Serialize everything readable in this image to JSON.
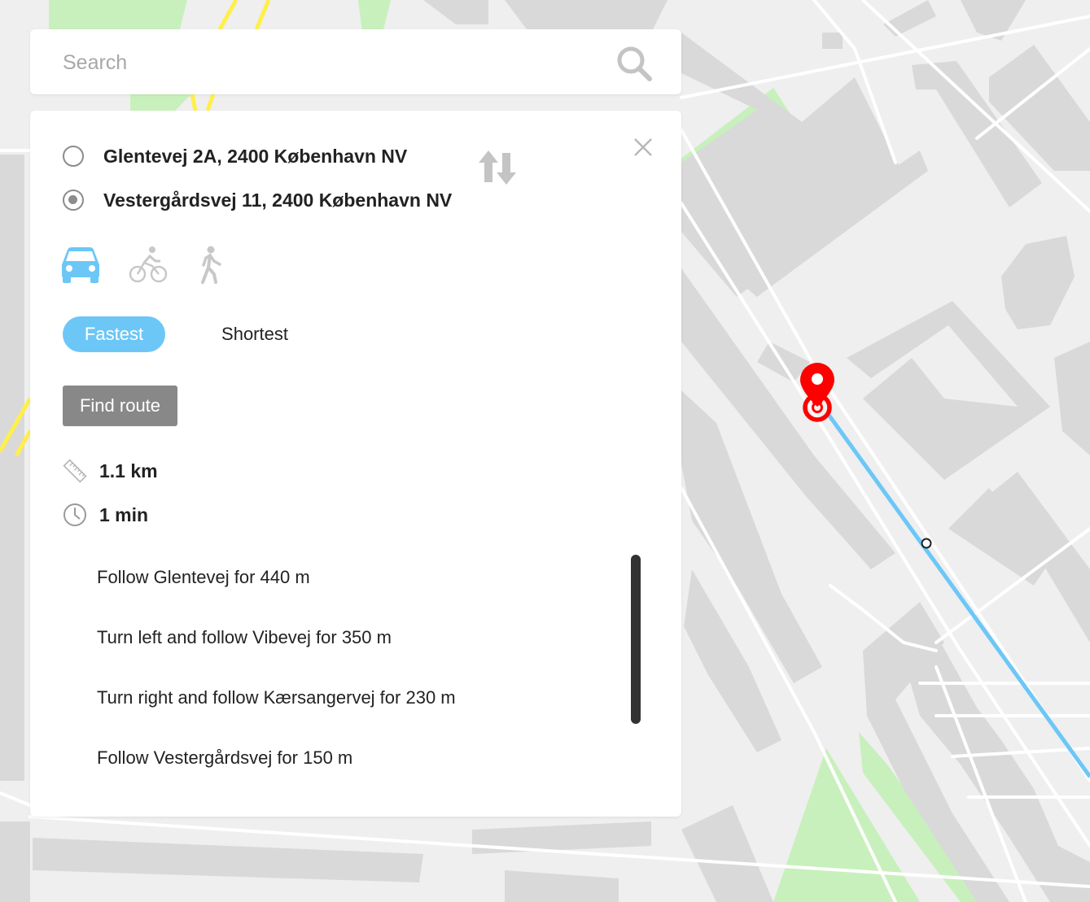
{
  "search": {
    "placeholder": "Search"
  },
  "route": {
    "origin": "Glentevej 2A, 2400 København NV",
    "destination": "Vestergårdsvej 11, 2400 København NV",
    "selected_location": "destination",
    "modes": [
      {
        "name": "car",
        "icon": "car-icon",
        "active": true
      },
      {
        "name": "bicycle",
        "icon": "bicycle-icon",
        "active": false
      },
      {
        "name": "walk",
        "icon": "pedestrian-icon",
        "active": false
      }
    ],
    "preferences": {
      "fastest": "Fastest",
      "shortest": "Shortest",
      "selected": "Fastest"
    },
    "find_button": "Find route",
    "distance": "1.1 km",
    "duration": "1 min",
    "steps": [
      "Follow Glentevej for 440 m",
      "Turn left and follow Vibevej for 350 m",
      "Turn right and follow Kærsangervej for 230 m",
      "Follow Vestergårdsvej for 150 m"
    ]
  },
  "colors": {
    "accent": "#6cc7f7",
    "route_line": "#6cc7f7",
    "marker": "#ff0000",
    "park": "#c8f0bc",
    "building": "#d9d9d9",
    "road_major": "#ffef4a",
    "button_grey": "#888888"
  }
}
